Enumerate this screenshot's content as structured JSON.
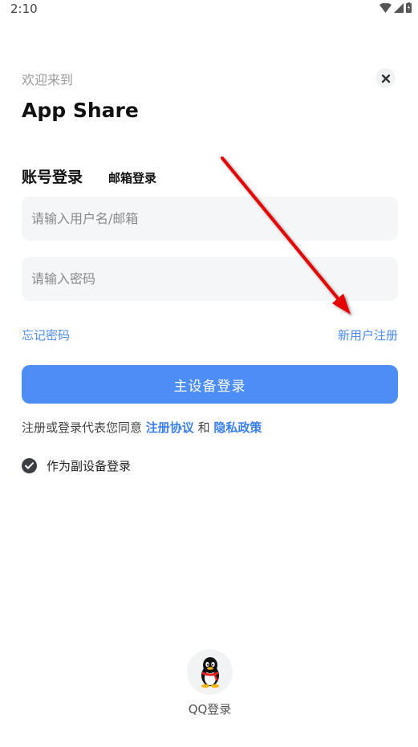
{
  "status_bar": {
    "time": "2:10"
  },
  "header": {
    "welcome": "欢迎来到",
    "app_name": "App Share"
  },
  "tabs": {
    "account_login": "账号登录",
    "email_login": "邮箱登录"
  },
  "form": {
    "username_placeholder": "请输入用户名/邮箱",
    "password_placeholder": "请输入密码",
    "username_value": "",
    "password_value": ""
  },
  "links": {
    "forgot_password": "忘记密码",
    "new_user_register": "新用户注册"
  },
  "primary_button": "主设备登录",
  "agreement": {
    "prefix": "注册或登录代表您同意 ",
    "terms": "注册协议",
    "and": " 和 ",
    "privacy": "隐私政策"
  },
  "secondary_device": {
    "label": "作为副设备登录",
    "checked": true
  },
  "social": {
    "qq_label": "QQ登录"
  },
  "colors": {
    "accent": "#4c8ef5",
    "link": "#4a8cf2",
    "annotation_arrow": "#e60000"
  }
}
